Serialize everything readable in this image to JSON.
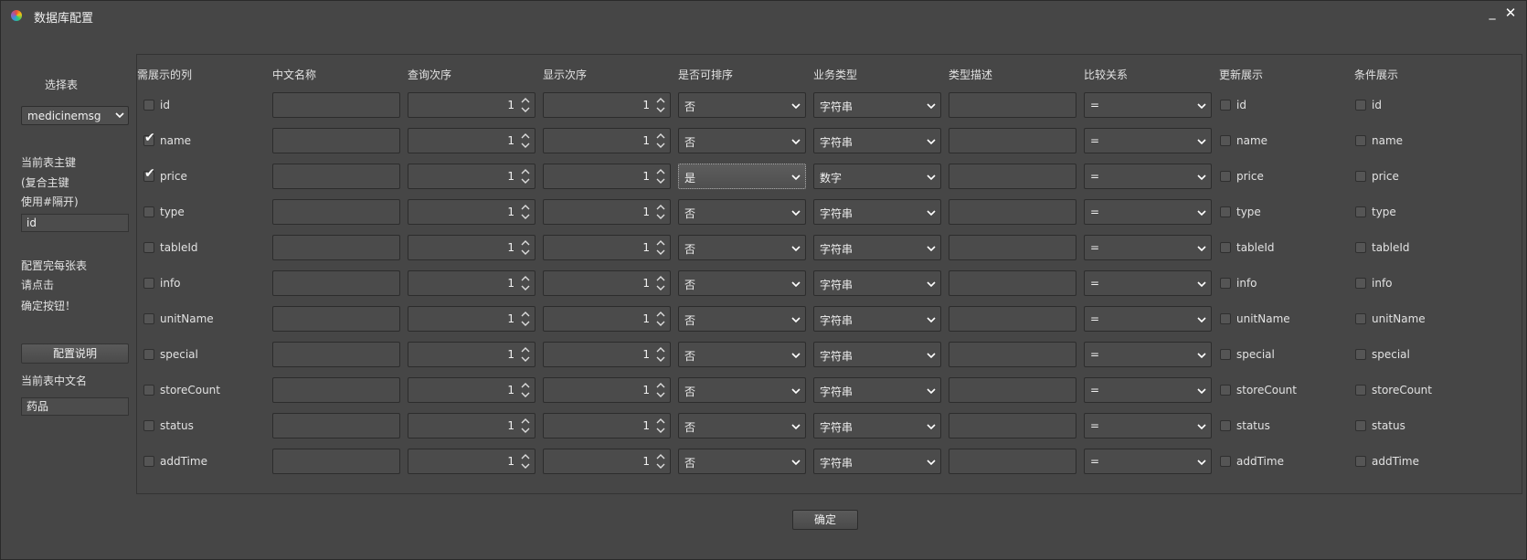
{
  "window": {
    "title": "数据库配置",
    "minimize": "_",
    "close": "✕"
  },
  "sidebar": {
    "select_table_label": "选择表",
    "table_select_value": "medicinemsg",
    "pk_line1": "当前表主键",
    "pk_line2": "(复合主键",
    "pk_line3": "使用#隔开)",
    "pk_value": "id",
    "note_line1": "配置完每张表",
    "note_line2": "请点击",
    "note_line3": "确定按钮！",
    "config_help_button": "配置说明",
    "cn_name_label": "当前表中文名",
    "cn_name_value": "药品"
  },
  "headers": [
    "需展示的列",
    "中文名称",
    "查询次序",
    "显示次序",
    "是否可排序",
    "业务类型",
    "类型描述",
    "比较关系",
    "更新展示",
    "条件展示"
  ],
  "rows": [
    {
      "name": "id",
      "show": false,
      "cn": "",
      "query_order": "1",
      "display_order": "1",
      "sortable": "否",
      "biz_type": "字符串",
      "type_desc": "",
      "compare": "=",
      "update_show": false,
      "cond_show": false
    },
    {
      "name": "name",
      "show": true,
      "cn": "",
      "query_order": "1",
      "display_order": "1",
      "sortable": "否",
      "biz_type": "字符串",
      "type_desc": "",
      "compare": "=",
      "update_show": false,
      "cond_show": false
    },
    {
      "name": "price",
      "show": true,
      "cn": "",
      "query_order": "1",
      "display_order": "1",
      "sortable": "是",
      "biz_type": "数字",
      "type_desc": "",
      "compare": "=",
      "update_show": false,
      "cond_show": false
    },
    {
      "name": "type",
      "show": false,
      "cn": "",
      "query_order": "1",
      "display_order": "1",
      "sortable": "否",
      "biz_type": "字符串",
      "type_desc": "",
      "compare": "=",
      "update_show": false,
      "cond_show": false
    },
    {
      "name": "tableId",
      "show": false,
      "cn": "",
      "query_order": "1",
      "display_order": "1",
      "sortable": "否",
      "biz_type": "字符串",
      "type_desc": "",
      "compare": "=",
      "update_show": false,
      "cond_show": false
    },
    {
      "name": "info",
      "show": false,
      "cn": "",
      "query_order": "1",
      "display_order": "1",
      "sortable": "否",
      "biz_type": "字符串",
      "type_desc": "",
      "compare": "=",
      "update_show": false,
      "cond_show": false
    },
    {
      "name": "unitName",
      "show": false,
      "cn": "",
      "query_order": "1",
      "display_order": "1",
      "sortable": "否",
      "biz_type": "字符串",
      "type_desc": "",
      "compare": "=",
      "update_show": false,
      "cond_show": false
    },
    {
      "name": "special",
      "show": false,
      "cn": "",
      "query_order": "1",
      "display_order": "1",
      "sortable": "否",
      "biz_type": "字符串",
      "type_desc": "",
      "compare": "=",
      "update_show": false,
      "cond_show": false
    },
    {
      "name": "storeCount",
      "show": false,
      "cn": "",
      "query_order": "1",
      "display_order": "1",
      "sortable": "否",
      "biz_type": "字符串",
      "type_desc": "",
      "compare": "=",
      "update_show": false,
      "cond_show": false
    },
    {
      "name": "status",
      "show": false,
      "cn": "",
      "query_order": "1",
      "display_order": "1",
      "sortable": "否",
      "biz_type": "字符串",
      "type_desc": "",
      "compare": "=",
      "update_show": false,
      "cond_show": false
    },
    {
      "name": "addTime",
      "show": false,
      "cn": "",
      "query_order": "1",
      "display_order": "1",
      "sortable": "否",
      "biz_type": "字符串",
      "type_desc": "",
      "compare": "=",
      "update_show": false,
      "cond_show": false
    }
  ],
  "ok_button": "确定",
  "icons": {
    "app": "app-logo-icon",
    "dropdown": "chevron-down-icon",
    "spin": "spin-arrows-icon",
    "check": "checkmark-icon"
  }
}
